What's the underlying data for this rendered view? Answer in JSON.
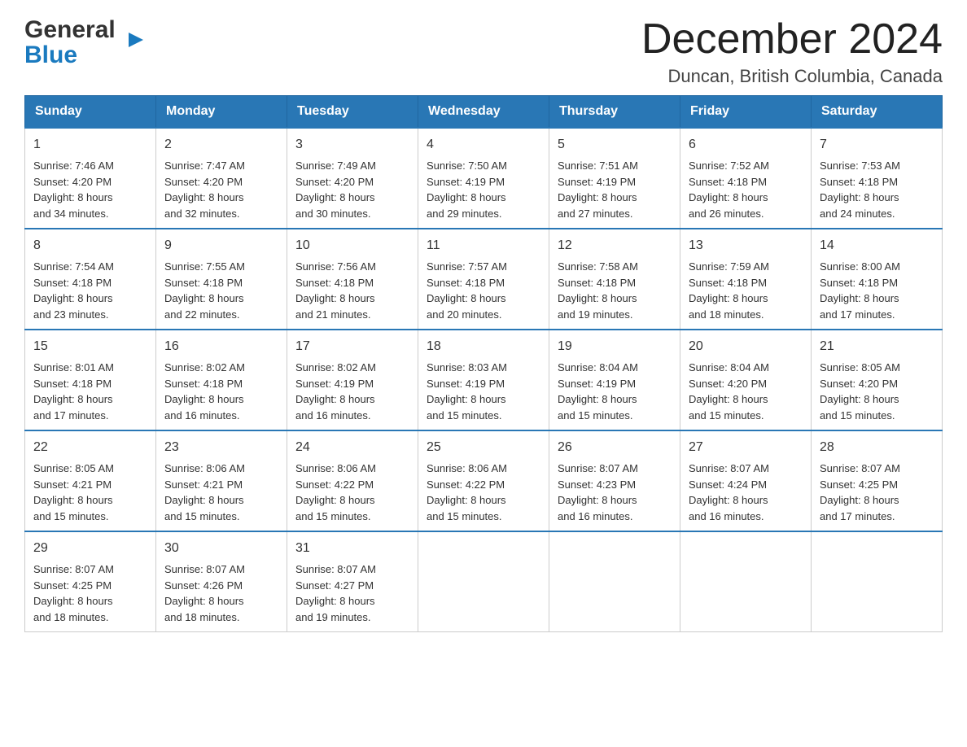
{
  "header": {
    "logo_general": "General",
    "logo_blue": "Blue",
    "month_title": "December 2024",
    "location": "Duncan, British Columbia, Canada"
  },
  "days_of_week": [
    "Sunday",
    "Monday",
    "Tuesday",
    "Wednesday",
    "Thursday",
    "Friday",
    "Saturday"
  ],
  "weeks": [
    [
      {
        "day": "1",
        "sunrise": "7:46 AM",
        "sunset": "4:20 PM",
        "daylight": "8 hours and 34 minutes."
      },
      {
        "day": "2",
        "sunrise": "7:47 AM",
        "sunset": "4:20 PM",
        "daylight": "8 hours and 32 minutes."
      },
      {
        "day": "3",
        "sunrise": "7:49 AM",
        "sunset": "4:20 PM",
        "daylight": "8 hours and 30 minutes."
      },
      {
        "day": "4",
        "sunrise": "7:50 AM",
        "sunset": "4:19 PM",
        "daylight": "8 hours and 29 minutes."
      },
      {
        "day": "5",
        "sunrise": "7:51 AM",
        "sunset": "4:19 PM",
        "daylight": "8 hours and 27 minutes."
      },
      {
        "day": "6",
        "sunrise": "7:52 AM",
        "sunset": "4:18 PM",
        "daylight": "8 hours and 26 minutes."
      },
      {
        "day": "7",
        "sunrise": "7:53 AM",
        "sunset": "4:18 PM",
        "daylight": "8 hours and 24 minutes."
      }
    ],
    [
      {
        "day": "8",
        "sunrise": "7:54 AM",
        "sunset": "4:18 PM",
        "daylight": "8 hours and 23 minutes."
      },
      {
        "day": "9",
        "sunrise": "7:55 AM",
        "sunset": "4:18 PM",
        "daylight": "8 hours and 22 minutes."
      },
      {
        "day": "10",
        "sunrise": "7:56 AM",
        "sunset": "4:18 PM",
        "daylight": "8 hours and 21 minutes."
      },
      {
        "day": "11",
        "sunrise": "7:57 AM",
        "sunset": "4:18 PM",
        "daylight": "8 hours and 20 minutes."
      },
      {
        "day": "12",
        "sunrise": "7:58 AM",
        "sunset": "4:18 PM",
        "daylight": "8 hours and 19 minutes."
      },
      {
        "day": "13",
        "sunrise": "7:59 AM",
        "sunset": "4:18 PM",
        "daylight": "8 hours and 18 minutes."
      },
      {
        "day": "14",
        "sunrise": "8:00 AM",
        "sunset": "4:18 PM",
        "daylight": "8 hours and 17 minutes."
      }
    ],
    [
      {
        "day": "15",
        "sunrise": "8:01 AM",
        "sunset": "4:18 PM",
        "daylight": "8 hours and 17 minutes."
      },
      {
        "day": "16",
        "sunrise": "8:02 AM",
        "sunset": "4:18 PM",
        "daylight": "8 hours and 16 minutes."
      },
      {
        "day": "17",
        "sunrise": "8:02 AM",
        "sunset": "4:19 PM",
        "daylight": "8 hours and 16 minutes."
      },
      {
        "day": "18",
        "sunrise": "8:03 AM",
        "sunset": "4:19 PM",
        "daylight": "8 hours and 15 minutes."
      },
      {
        "day": "19",
        "sunrise": "8:04 AM",
        "sunset": "4:19 PM",
        "daylight": "8 hours and 15 minutes."
      },
      {
        "day": "20",
        "sunrise": "8:04 AM",
        "sunset": "4:20 PM",
        "daylight": "8 hours and 15 minutes."
      },
      {
        "day": "21",
        "sunrise": "8:05 AM",
        "sunset": "4:20 PM",
        "daylight": "8 hours and 15 minutes."
      }
    ],
    [
      {
        "day": "22",
        "sunrise": "8:05 AM",
        "sunset": "4:21 PM",
        "daylight": "8 hours and 15 minutes."
      },
      {
        "day": "23",
        "sunrise": "8:06 AM",
        "sunset": "4:21 PM",
        "daylight": "8 hours and 15 minutes."
      },
      {
        "day": "24",
        "sunrise": "8:06 AM",
        "sunset": "4:22 PM",
        "daylight": "8 hours and 15 minutes."
      },
      {
        "day": "25",
        "sunrise": "8:06 AM",
        "sunset": "4:22 PM",
        "daylight": "8 hours and 15 minutes."
      },
      {
        "day": "26",
        "sunrise": "8:07 AM",
        "sunset": "4:23 PM",
        "daylight": "8 hours and 16 minutes."
      },
      {
        "day": "27",
        "sunrise": "8:07 AM",
        "sunset": "4:24 PM",
        "daylight": "8 hours and 16 minutes."
      },
      {
        "day": "28",
        "sunrise": "8:07 AM",
        "sunset": "4:25 PM",
        "daylight": "8 hours and 17 minutes."
      }
    ],
    [
      {
        "day": "29",
        "sunrise": "8:07 AM",
        "sunset": "4:25 PM",
        "daylight": "8 hours and 18 minutes."
      },
      {
        "day": "30",
        "sunrise": "8:07 AM",
        "sunset": "4:26 PM",
        "daylight": "8 hours and 18 minutes."
      },
      {
        "day": "31",
        "sunrise": "8:07 AM",
        "sunset": "4:27 PM",
        "daylight": "8 hours and 19 minutes."
      },
      null,
      null,
      null,
      null
    ]
  ],
  "labels": {
    "sunrise": "Sunrise:",
    "sunset": "Sunset:",
    "daylight": "Daylight:"
  }
}
